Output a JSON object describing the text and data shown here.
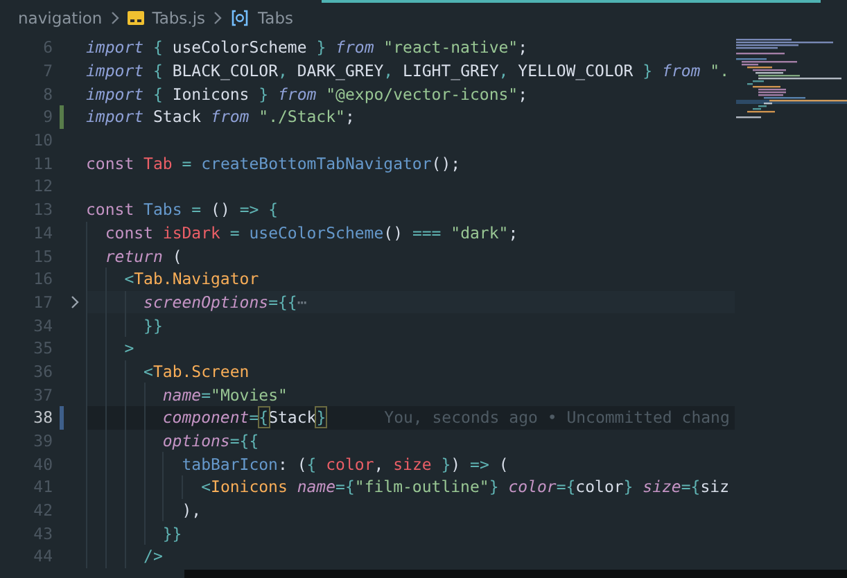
{
  "breadcrumb": [
    {
      "kind": "folder",
      "label": "navigation"
    },
    {
      "kind": "file",
      "label": "Tabs.js"
    },
    {
      "kind": "symbol",
      "label": "Tabs"
    }
  ],
  "lines": [
    {
      "number": "6",
      "tokens": [
        {
          "kind": "keyword",
          "text": "import "
        },
        {
          "kind": "punct",
          "text": "{ "
        },
        {
          "kind": "plain",
          "text": "useColorScheme "
        },
        {
          "kind": "punct",
          "text": "} "
        },
        {
          "kind": "keyword",
          "text": "from "
        },
        {
          "kind": "string",
          "text": "\"react-native\""
        },
        {
          "kind": "plain",
          "text": ";"
        }
      ]
    },
    {
      "number": "7",
      "tokens": [
        {
          "kind": "keyword",
          "text": "import "
        },
        {
          "kind": "punct",
          "text": "{ "
        },
        {
          "kind": "plain",
          "text": "BLACK_COLOR"
        },
        {
          "kind": "punct",
          "text": ", "
        },
        {
          "kind": "plain",
          "text": "DARK_GREY"
        },
        {
          "kind": "punct",
          "text": ", "
        },
        {
          "kind": "plain",
          "text": "LIGHT_GREY"
        },
        {
          "kind": "punct",
          "text": ", "
        },
        {
          "kind": "plain",
          "text": "YELLOW_COLOR "
        },
        {
          "kind": "punct",
          "text": "} "
        },
        {
          "kind": "keyword",
          "text": "from "
        },
        {
          "kind": "string",
          "text": "\"."
        }
      ]
    },
    {
      "number": "8",
      "tokens": [
        {
          "kind": "keyword",
          "text": "import "
        },
        {
          "kind": "punct",
          "text": "{ "
        },
        {
          "kind": "plain",
          "text": "Ionicons "
        },
        {
          "kind": "punct",
          "text": "} "
        },
        {
          "kind": "keyword",
          "text": "from "
        },
        {
          "kind": "string",
          "text": "\"@expo/vector-icons\""
        },
        {
          "kind": "plain",
          "text": ";"
        }
      ]
    },
    {
      "number": "9",
      "added": true,
      "tokens": [
        {
          "kind": "keyword",
          "text": "import "
        },
        {
          "kind": "plain",
          "text": "Stack "
        },
        {
          "kind": "keyword",
          "text": "from "
        },
        {
          "kind": "string",
          "text": "\"./Stack\""
        },
        {
          "kind": "plain",
          "text": ";"
        }
      ]
    },
    {
      "number": "10"
    },
    {
      "number": "11",
      "tokens": [
        {
          "kind": "decl",
          "text": "const "
        },
        {
          "kind": "variable",
          "text": "Tab "
        },
        {
          "kind": "punct",
          "text": "= "
        },
        {
          "kind": "function",
          "text": "createBottomTabNavigator"
        },
        {
          "kind": "plain",
          "text": "();"
        }
      ]
    },
    {
      "number": "12"
    },
    {
      "number": "13",
      "tokens": [
        {
          "kind": "decl",
          "text": "const "
        },
        {
          "kind": "function",
          "text": "Tabs "
        },
        {
          "kind": "punct",
          "text": "= "
        },
        {
          "kind": "plain",
          "text": "() "
        },
        {
          "kind": "punct",
          "text": "=> {"
        }
      ]
    },
    {
      "number": "14",
      "tokens": [
        {
          "kind": "decl",
          "text": "  const "
        },
        {
          "kind": "variable",
          "text": "isDark "
        },
        {
          "kind": "punct",
          "text": "= "
        },
        {
          "kind": "function",
          "text": "useColorScheme"
        },
        {
          "kind": "plain",
          "text": "() "
        },
        {
          "kind": "punct",
          "text": "=== "
        },
        {
          "kind": "string",
          "text": "\"dark\""
        },
        {
          "kind": "plain",
          "text": ";"
        }
      ]
    },
    {
      "number": "15",
      "tokens": [
        {
          "kind": "control",
          "text": "  return"
        },
        {
          "kind": "plain",
          "text": " ("
        }
      ]
    },
    {
      "number": "16",
      "tokens": [
        {
          "kind": "punct",
          "text": "    <"
        },
        {
          "kind": "tag",
          "text": "Tab.Navigator"
        }
      ]
    },
    {
      "number": "17",
      "folded": true,
      "tokens": [
        {
          "kind": "attribute",
          "text": "      screenOptions"
        },
        {
          "kind": "punct",
          "text": "={{"
        },
        {
          "kind": "ellipsis",
          "text": "⋯"
        }
      ]
    },
    {
      "number": "34",
      "tokens": [
        {
          "kind": "punct",
          "text": "      }}"
        }
      ]
    },
    {
      "number": "35",
      "tokens": [
        {
          "kind": "punct",
          "text": "    >"
        }
      ]
    },
    {
      "number": "36",
      "tokens": [
        {
          "kind": "punct",
          "text": "      <"
        },
        {
          "kind": "tag",
          "text": "Tab.Screen"
        }
      ]
    },
    {
      "number": "37",
      "tokens": [
        {
          "kind": "attribute",
          "text": "        name"
        },
        {
          "kind": "punct",
          "text": "="
        },
        {
          "kind": "string",
          "text": "\"Movies\""
        }
      ]
    },
    {
      "number": "38",
      "modified": true,
      "current": true,
      "blame": "You, seconds ago • Uncommitted chang",
      "tokens": [
        {
          "kind": "attribute",
          "text": "        component"
        },
        {
          "kind": "punct",
          "text": "="
        },
        {
          "kind": "bracket",
          "text": "{"
        },
        {
          "kind": "plain",
          "text": "Stack"
        },
        {
          "kind": "bracket",
          "text": "}"
        }
      ]
    },
    {
      "number": "39",
      "tokens": [
        {
          "kind": "attribute",
          "text": "        options"
        },
        {
          "kind": "punct",
          "text": "={{"
        }
      ]
    },
    {
      "number": "40",
      "tokens": [
        {
          "kind": "function",
          "text": "          tabBarIcon"
        },
        {
          "kind": "plain",
          "text": ": ("
        },
        {
          "kind": "punct",
          "text": "{ "
        },
        {
          "kind": "variable",
          "text": "color"
        },
        {
          "kind": "plain",
          "text": ", "
        },
        {
          "kind": "variable",
          "text": "size "
        },
        {
          "kind": "punct",
          "text": "}"
        },
        {
          "kind": "plain",
          "text": ") "
        },
        {
          "kind": "punct",
          "text": "=> "
        },
        {
          "kind": "plain",
          "text": "("
        }
      ]
    },
    {
      "number": "41",
      "tokens": [
        {
          "kind": "punct",
          "text": "            <"
        },
        {
          "kind": "tag",
          "text": "Ionicons "
        },
        {
          "kind": "attribute",
          "text": "name"
        },
        {
          "kind": "punct",
          "text": "={"
        },
        {
          "kind": "string",
          "text": "\"film-outline\""
        },
        {
          "kind": "punct",
          "text": "} "
        },
        {
          "kind": "attribute",
          "text": "color"
        },
        {
          "kind": "punct",
          "text": "={"
        },
        {
          "kind": "plain",
          "text": "color"
        },
        {
          "kind": "punct",
          "text": "} "
        },
        {
          "kind": "attribute",
          "text": "size"
        },
        {
          "kind": "punct",
          "text": "={"
        },
        {
          "kind": "plain",
          "text": "siz"
        }
      ]
    },
    {
      "number": "42",
      "tokens": [
        {
          "kind": "plain",
          "text": "          ),"
        }
      ]
    },
    {
      "number": "43",
      "tokens": [
        {
          "kind": "punct",
          "text": "        }}"
        }
      ]
    },
    {
      "number": "44",
      "tokens": [
        {
          "kind": "punct",
          "text": "      />"
        }
      ]
    }
  ]
}
